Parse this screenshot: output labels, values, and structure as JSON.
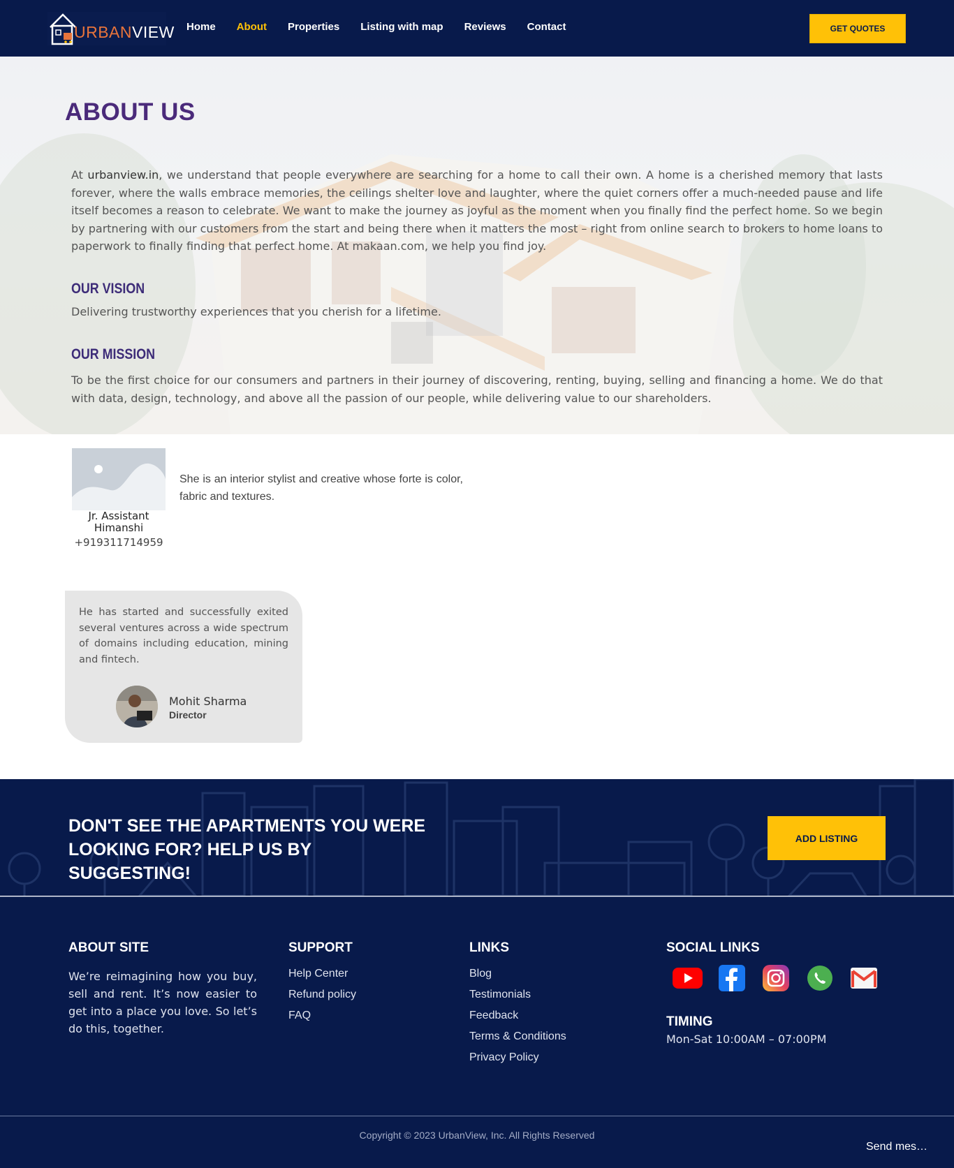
{
  "brand": {
    "name_part1": "URBAN",
    "name_part2": "VIEW"
  },
  "nav": {
    "items": [
      {
        "label": "Home",
        "active": false
      },
      {
        "label": "About",
        "active": true
      },
      {
        "label": "Properties",
        "active": false
      },
      {
        "label": "Listing with map",
        "active": false
      },
      {
        "label": "Reviews",
        "active": false
      },
      {
        "label": "Contact",
        "active": false
      }
    ],
    "cta_label": "GET QUOTES"
  },
  "about": {
    "title": "ABOUT US",
    "para_prefix": "At ",
    "site": "urbanview.in",
    "para_rest": ", we understand that people everywhere are searching for a home to call their own. A home is a cherished memory that lasts forever, where the walls embrace memories, the ceilings shelter love and laughter, where the quiet corners offer a much-needed pause and life itself becomes a reason to celebrate. We want to make the journey as joyful as the moment when you finally find the perfect home. So we begin by partnering with our customers from the start and being there when it matters the most – right from online search to brokers to home loans to paperwork to finally finding that perfect home. At makaan.com, we help you find joy.",
    "vision_title": "OUR VISION",
    "vision_text": "Delivering trustworthy experiences that you cherish for a lifetime.",
    "mission_title": "OUR MISSION",
    "mission_text": "To be the first choice for our consumers and partners in their journey of discovering, renting, buying, selling and financing a home. We do that with data, design, technology, and above all the passion of our people, while delivering value to our shareholders."
  },
  "team": {
    "role": "Jr. Assistant",
    "name": "Himanshi",
    "phone": "+919311714959",
    "description": "She is an interior stylist and creative whose forte is color, fabric and textures."
  },
  "testimonial": {
    "text": "He has started and successfully exited several ventures across a wide spectrum of domains including education, mining and fintech.",
    "name": "Mohit Sharma",
    "role": "Director"
  },
  "cta": {
    "line1": "DON'T SEE THE APARTMENTS YOU WERE",
    "line2": "LOOKING FOR? HELP US BY SUGGESTING!",
    "button": "ADD LISTING"
  },
  "footer": {
    "about_title": "ABOUT SITE",
    "about_text": "We’re reimagining how you buy, sell and rent. It’s now easier to get into a place you love. So let’s do this, together.",
    "support_title": "SUPPORT",
    "support_links": [
      "Help Center",
      "Refund policy",
      "FAQ"
    ],
    "links_title": "LINKS",
    "links": [
      "Blog",
      "Testimonials",
      "Feedback",
      "Terms & Conditions",
      "Privacy Policy"
    ],
    "social_title": "SOCIAL LINKS",
    "social_icons": [
      "youtube-icon",
      "facebook-icon",
      "instagram-icon",
      "whatsapp-icon",
      "gmail-icon"
    ],
    "timing_title": "TIMING",
    "timing_text": "Mon-Sat  10:00AM – 07:00PM",
    "copyright": "Copyright © 2023 UrbanView, Inc. All Rights Reserved",
    "chat_label": "Send mes…"
  },
  "colors": {
    "navy": "#081a4b",
    "accent": "#ffc107",
    "title_purple": "#4a2a7a"
  }
}
